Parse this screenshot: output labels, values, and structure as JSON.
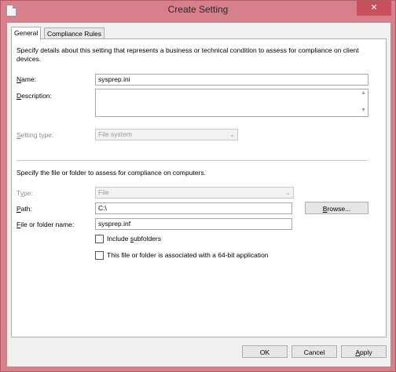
{
  "window": {
    "title": "Create Setting",
    "close_symbol": "✕"
  },
  "tabs": [
    {
      "label": "General"
    },
    {
      "label": "Compliance Rules"
    }
  ],
  "general": {
    "intro": "Specify details about this setting that represents a business or technical condition to assess for compliance on client devices.",
    "name_label": "Name:",
    "name_value": "sysprep.ini",
    "description_label": "Description:",
    "description_value": "",
    "setting_type_label": "Setting type:",
    "setting_type_value": "File system",
    "file_intro": "Specify the file or folder to assess for compliance on computers.",
    "type_label": "Type:",
    "type_value": "File",
    "path_label": "Path:",
    "path_value": "C:\\",
    "browse_label": "Browse...",
    "file_name_label": "File or folder name:",
    "file_name_value": "sysprep.inf",
    "include_subfolders_label": "Include subfolders",
    "include_subfolders_checked": false,
    "is64_label": "This file or folder is associated with a 64-bit application",
    "is64_checked": false
  },
  "footer": {
    "ok_label": "OK",
    "cancel_label": "Cancel",
    "apply_label": "Apply"
  },
  "colors": {
    "frame": "#d77f8a",
    "close_button": "#c7505c",
    "panel": "#ffffff",
    "dialog_bg": "#f0f0f0"
  }
}
